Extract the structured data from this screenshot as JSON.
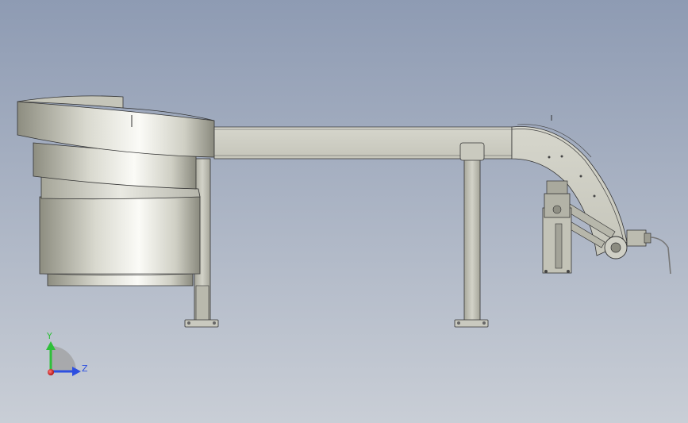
{
  "viewport": {
    "background_top": "#8e9bb3",
    "background_bottom": "#c9ced6",
    "model_light": "#eeeeea",
    "model_mid": "#c8c8bc",
    "model_dark": "#7f7f74",
    "edge": "#2f2f2f"
  },
  "triad": {
    "y_label": "Y",
    "z_label": "Z",
    "y_color": "#2fbf3a",
    "z_color": "#2d4fe0",
    "x_color": "#e02a2a"
  }
}
